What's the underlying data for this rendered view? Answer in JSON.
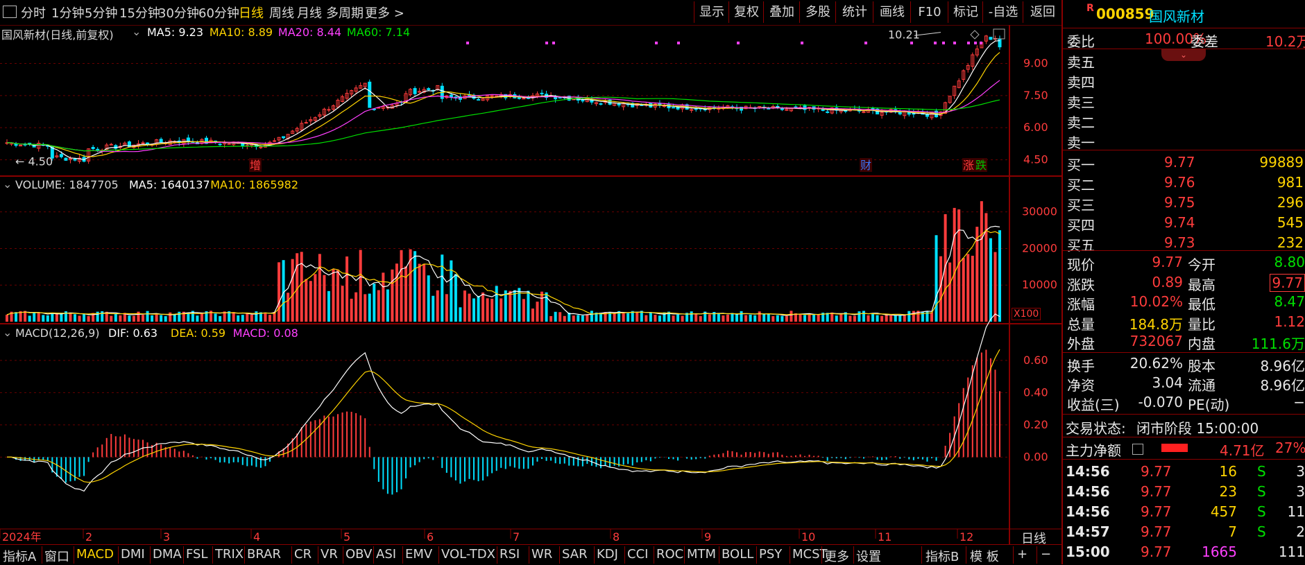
{
  "toolbar": {
    "periods": [
      "分时",
      "1分钟",
      "5分钟",
      "15分钟",
      "30分钟",
      "60分钟",
      "日线",
      "周线",
      "月线",
      "多周期",
      "更多 >"
    ],
    "active_period": "日线",
    "right_buttons": [
      "显示",
      "复权",
      "叠加",
      "多股",
      "统计",
      "画线",
      "F10",
      "标记",
      "-自选",
      "返回"
    ]
  },
  "price_panel": {
    "title": "国风新材(日线,前复权)",
    "ma": [
      {
        "label": "MA5: 9.23",
        "color": "#ffffff"
      },
      {
        "label": "MA10: 8.89",
        "color": "#ffd400"
      },
      {
        "label": "MA20: 8.44",
        "color": "#ff40ff"
      },
      {
        "label": "MA60: 7.14",
        "color": "#00e000"
      }
    ],
    "y_ticks": [
      "9.00",
      "7.50",
      "6.00",
      "4.50"
    ],
    "high_label": "10.21",
    "low_label": "4.50",
    "markers": [
      "增",
      "财",
      "涨",
      "跌"
    ]
  },
  "volume_panel": {
    "title": "VOLUME: 1847705",
    "ma": [
      {
        "label": "MA5: 1640137",
        "color": "#ffffff"
      },
      {
        "label": "MA10: 1865982",
        "color": "#ffd400"
      }
    ],
    "y_ticks": [
      "30000",
      "20000",
      "10000"
    ],
    "unit": "X100"
  },
  "macd_panel": {
    "title": "MACD(12,26,9)",
    "ma": [
      {
        "label": "DIF: 0.63",
        "color": "#ffffff"
      },
      {
        "label": "DEA: 0.59",
        "color": "#ffd400"
      },
      {
        "label": "MACD: 0.08",
        "color": "#ff40ff"
      }
    ],
    "y_ticks": [
      "0.60",
      "0.40",
      "0.20",
      "0.00"
    ]
  },
  "x_axis": {
    "labels": [
      "2024年",
      "2",
      "3",
      "4",
      "5",
      "6",
      "7",
      "8",
      "9",
      "10",
      "11",
      "12"
    ],
    "period_label": "日线"
  },
  "bottom_tabs": [
    "指标A",
    "窗口",
    "MACD",
    "DMI",
    "DMA",
    "FSL",
    "TRIX",
    "BRAR",
    "CR",
    "VR",
    "OBV",
    "ASI",
    "EMV",
    "VOL-TDX",
    "RSI",
    "WR",
    "SAR",
    "KDJ",
    "CCI",
    "ROC",
    "MTM",
    "BOLL",
    "PSY",
    "MCST",
    "更多",
    "设置"
  ],
  "bottom_right": [
    "指标B",
    "模 板",
    "+",
    "−"
  ],
  "active_tab": "MACD",
  "stock": {
    "code": "000859",
    "name": "国风新材",
    "badge": "R"
  },
  "weibi": {
    "label1": "委比",
    "value1": "100.00%",
    "label2": "委差",
    "value2": "10.2万"
  },
  "sell_orders": [
    {
      "label": "卖五",
      "price": "",
      "vol": ""
    },
    {
      "label": "卖四",
      "price": "",
      "vol": ""
    },
    {
      "label": "卖三",
      "price": "",
      "vol": ""
    },
    {
      "label": "卖二",
      "price": "",
      "vol": ""
    },
    {
      "label": "卖一",
      "price": "",
      "vol": ""
    }
  ],
  "buy_orders": [
    {
      "label": "买一",
      "price": "9.77",
      "vol": "99889"
    },
    {
      "label": "买二",
      "price": "9.76",
      "vol": "981"
    },
    {
      "label": "买三",
      "price": "9.75",
      "vol": "296"
    },
    {
      "label": "买四",
      "price": "9.74",
      "vol": "545"
    },
    {
      "label": "买五",
      "price": "9.73",
      "vol": "232"
    }
  ],
  "quote": [
    {
      "l1": "现价",
      "v1": "9.77",
      "c1": "red",
      "l2": "今开",
      "v2": "8.80",
      "c2": "grn"
    },
    {
      "l1": "涨跌",
      "v1": "0.89",
      "c1": "red",
      "l2": "最高",
      "v2": "9.77",
      "c2": "red"
    },
    {
      "l1": "涨幅",
      "v1": "10.02%",
      "c1": "red",
      "l2": "最低",
      "v2": "8.47",
      "c2": "grn"
    },
    {
      "l1": "总量",
      "v1": "184.8万",
      "c1": "yel",
      "l2": "量比",
      "v2": "1.12",
      "c2": "red"
    },
    {
      "l1": "外盘",
      "v1": "732067",
      "c1": "red",
      "l2": "内盘",
      "v2": "111.6万",
      "c2": "grn"
    }
  ],
  "fundamentals": [
    {
      "l1": "换手",
      "v1": "20.62%",
      "l2": "股本",
      "v2": "8.96亿"
    },
    {
      "l1": "净资",
      "v1": "3.04",
      "l2": "流通",
      "v2": "8.96亿"
    },
    {
      "l1": "收益(三)",
      "v1": "-0.070",
      "l2": "PE(动)",
      "v2": "−"
    }
  ],
  "status": {
    "label": "交易状态:",
    "value": "闭市阶段 15:00:00"
  },
  "main_flow": {
    "label": "主力净额",
    "value": "4.71亿",
    "pct": "27%"
  },
  "ticks": [
    {
      "time": "14:56",
      "price": "9.77",
      "vol": "16",
      "side": "S",
      "n": "3"
    },
    {
      "time": "14:56",
      "price": "9.77",
      "vol": "23",
      "side": "S",
      "n": "3"
    },
    {
      "time": "14:56",
      "price": "9.77",
      "vol": "457",
      "side": "S",
      "n": "11"
    },
    {
      "time": "14:57",
      "price": "9.77",
      "vol": "7",
      "side": "S",
      "n": "2"
    },
    {
      "time": "15:00",
      "price": "9.77",
      "vol": "1665",
      "side": "",
      "n": "111"
    }
  ],
  "chart_data": {
    "type": "candlestick",
    "title": "国风新材(日线,前复权)",
    "months": [
      "2024-01",
      "2024-02",
      "2024-03",
      "2024-04",
      "2024-05",
      "2024-06",
      "2024-07",
      "2024-08",
      "2024-09",
      "2024-10",
      "2024-11",
      "2024-12"
    ],
    "close_by_month_end": [
      5.0,
      5.3,
      5.2,
      7.0,
      7.3,
      7.6,
      7.1,
      6.9,
      6.8,
      6.7,
      6.5,
      9.77
    ],
    "price_range": [
      4.0,
      10.6
    ],
    "high": 10.21,
    "low": 4.5,
    "last_ma": {
      "MA5": 9.23,
      "MA10": 8.89,
      "MA20": 8.44,
      "MA60": 7.14
    },
    "volume_range": [
      0,
      36000
    ],
    "last_volume": 1847705,
    "macd_range": [
      -0.42,
      0.72
    ],
    "last_macd": {
      "DIF": 0.63,
      "DEA": 0.59,
      "MACD": 0.08
    }
  }
}
